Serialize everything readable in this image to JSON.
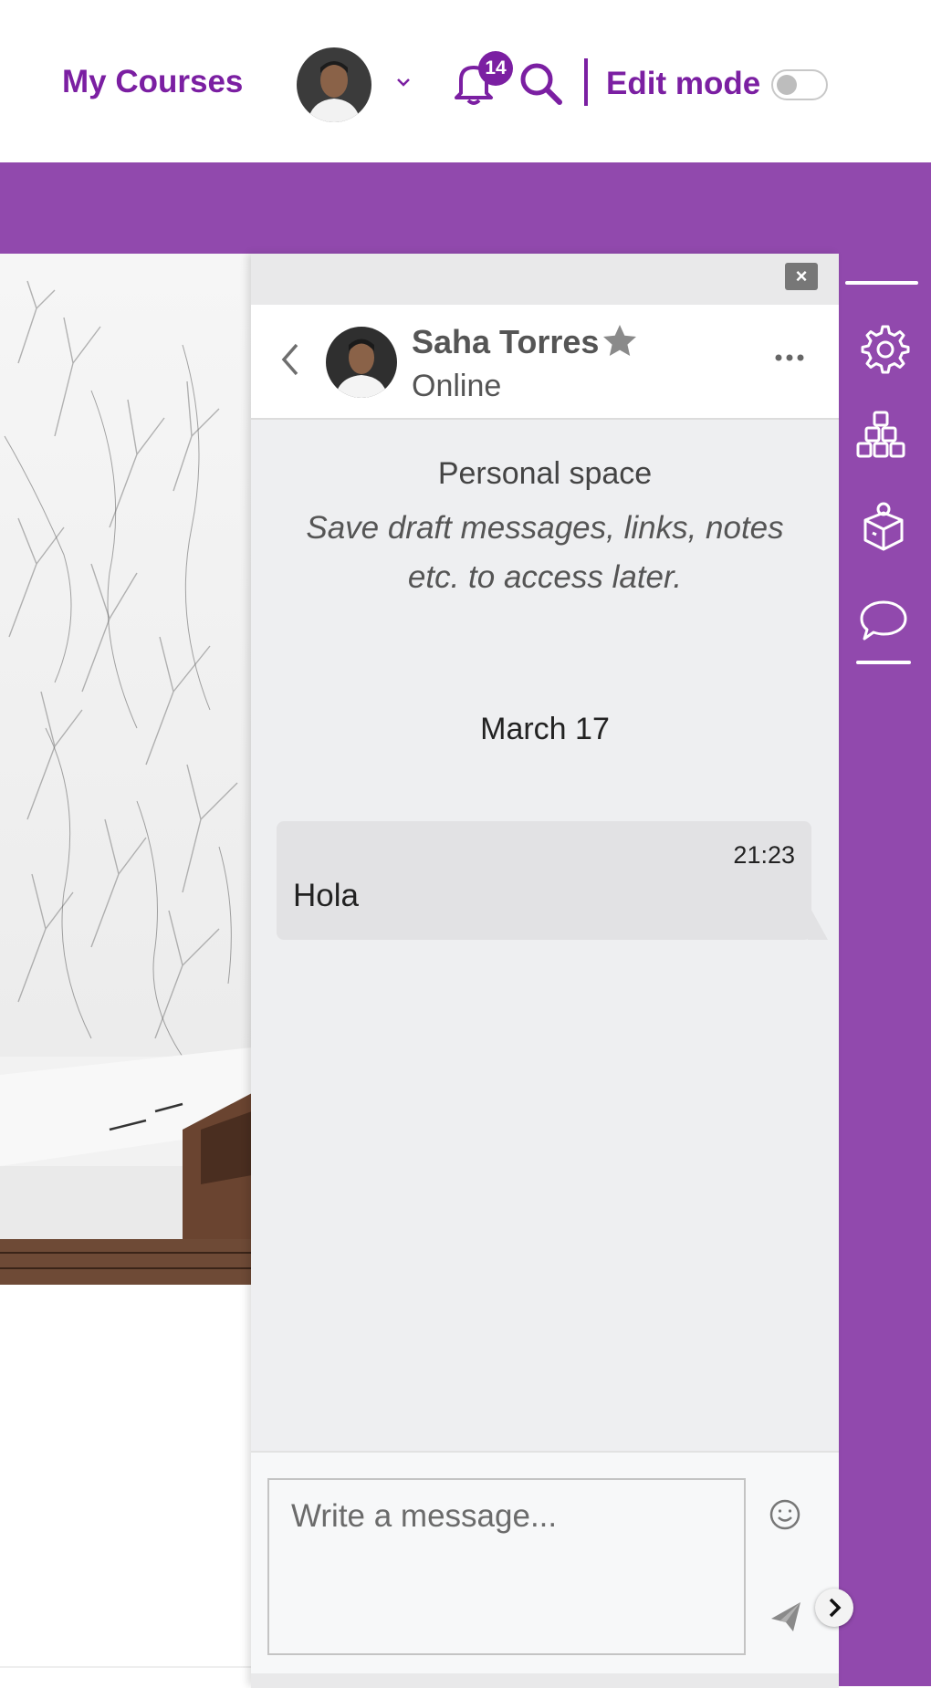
{
  "header": {
    "my_courses": "My Courses",
    "notification_count": "14",
    "edit_mode_label": "Edit mode",
    "edit_mode_on": false
  },
  "conversation": {
    "name": "Saha Torres",
    "status": "Online",
    "close_label": "×"
  },
  "personal_space": {
    "title": "Personal space",
    "description": "Save draft messages, links, notes etc. to access later."
  },
  "messages": {
    "date": "March 17",
    "items": [
      {
        "time": "21:23",
        "text": "Hola"
      }
    ]
  },
  "composer": {
    "placeholder": "Write a message..."
  },
  "colors": {
    "brand_purple": "#7b1fa2",
    "drawer_purple": "#9149ad",
    "panel_bg": "#eeeff1"
  },
  "icons": {
    "header": [
      "chevron-down-icon",
      "bell-icon",
      "search-icon"
    ],
    "drawer": [
      "gear-icon",
      "blocks-icon",
      "box-icon",
      "chat-bubble-icon"
    ],
    "panel": [
      "close-icon",
      "chevron-left-icon",
      "star-icon",
      "more-icon",
      "smiley-icon",
      "send-icon",
      "chevron-right-icon"
    ]
  }
}
